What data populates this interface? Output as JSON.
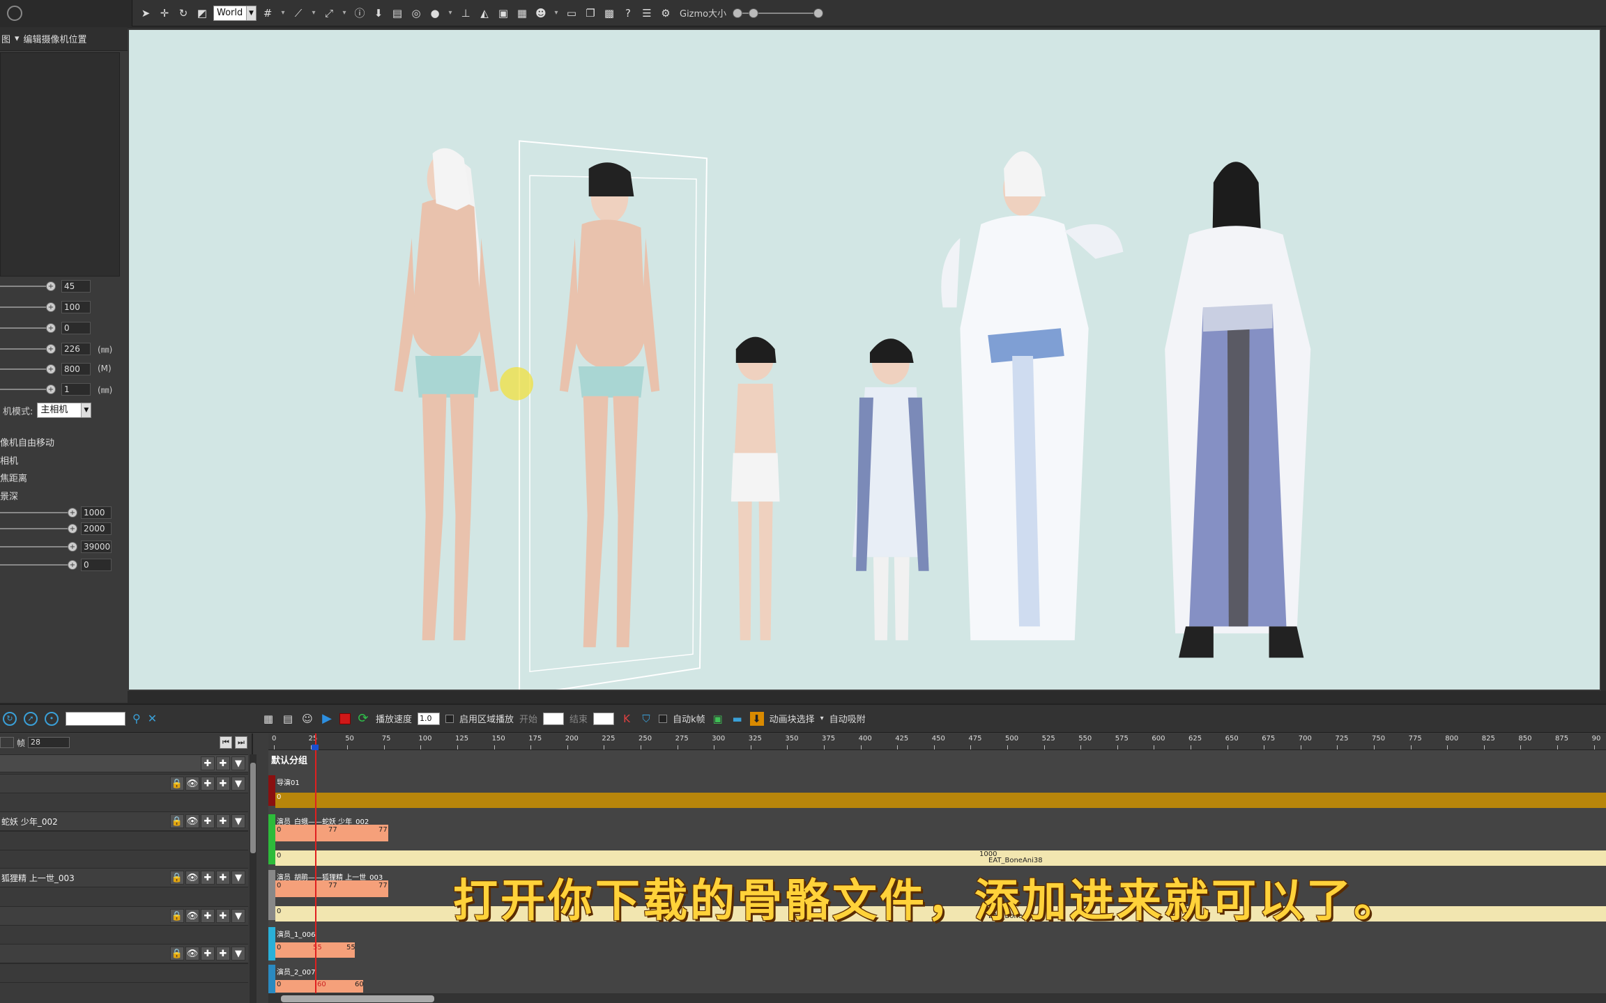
{
  "toolbar": {
    "space_value": "World",
    "gizmo_label": "Gizmo大小",
    "gizmo_level": 0.2
  },
  "left_panel": {
    "header_left": "图",
    "header_right": "编辑摄像机位置",
    "sliders": [
      {
        "value": "45",
        "unit": ""
      },
      {
        "value": "100",
        "unit": ""
      },
      {
        "value": "0",
        "unit": ""
      },
      {
        "value": "226",
        "unit": "(㎜)"
      },
      {
        "value": "800",
        "unit": "(M)"
      },
      {
        "value": "1",
        "unit": "(㎜)"
      }
    ],
    "mode_label": "机模式:",
    "mode_value": "主相机",
    "options": [
      "像机自由移动",
      "相机",
      "焦距离",
      "景深"
    ],
    "sliders2": [
      {
        "value": "1000"
      },
      {
        "value": "2000"
      },
      {
        "value": "39000"
      },
      {
        "value": "0"
      }
    ]
  },
  "timeline": {
    "toolbar": {
      "speed_label": "播放速度",
      "speed_value": "1.0",
      "range_label": "启用区域播放",
      "start_label": "开始",
      "end_label": "结束",
      "auto_key_label": "自动k帧",
      "block_select_label": "动画块选择",
      "auto_snap_label": "自动吸附"
    },
    "frame_label": "帧",
    "frame_value": "28",
    "tracks": [
      {
        "name": ""
      },
      {
        "name": ""
      },
      {
        "name": "蛇妖 少年_002"
      },
      {
        "name": ""
      },
      {
        "name": "狐狸精 上一世_003"
      },
      {
        "name": ""
      },
      {
        "name": ""
      },
      {
        "name": ""
      }
    ],
    "ruler_ticks": [
      "0",
      "25",
      "50",
      "75",
      "100",
      "125",
      "150",
      "175",
      "200",
      "225",
      "250",
      "275",
      "300",
      "325",
      "350",
      "375",
      "400",
      "425",
      "450",
      "475",
      "500",
      "525",
      "550",
      "575",
      "600",
      "625",
      "650",
      "675",
      "700",
      "725",
      "750",
      "775",
      "800",
      "825",
      "850",
      "875",
      "90"
    ],
    "group_label": "默认分组",
    "lanes": [
      {
        "label": "导演01",
        "start": "0"
      },
      {
        "label": "演员_白蛾——蛇妖 少年_002",
        "start": "0",
        "mid": "77",
        "end": "77",
        "sub_start": "0",
        "sub_end": "1000",
        "sub_name": "EAT_BoneAni38"
      },
      {
        "label": "演员_胡鹃——狐狸精 上一世_003",
        "start": "0",
        "mid": "77",
        "end": "77",
        "sub_start": "0",
        "sub_end": "1000",
        "sub_name": "EAT_BoneAn"
      },
      {
        "label": "演员_1_006",
        "start": "0",
        "mid": "55",
        "end": "55"
      },
      {
        "label": "演员_2_007",
        "start": "0",
        "mid": "60",
        "end": "60"
      }
    ],
    "current_frame": 28
  },
  "subtitle": "打开你下载的骨骼文件，添加进来就可以了。",
  "colors": {
    "viewport_bg": "#d2e6e4",
    "director_bar": "#b8860b",
    "clip_bar": "#f5a07a",
    "anim_bar": "#f2e6b0",
    "subtitle": "#ffd23a"
  }
}
